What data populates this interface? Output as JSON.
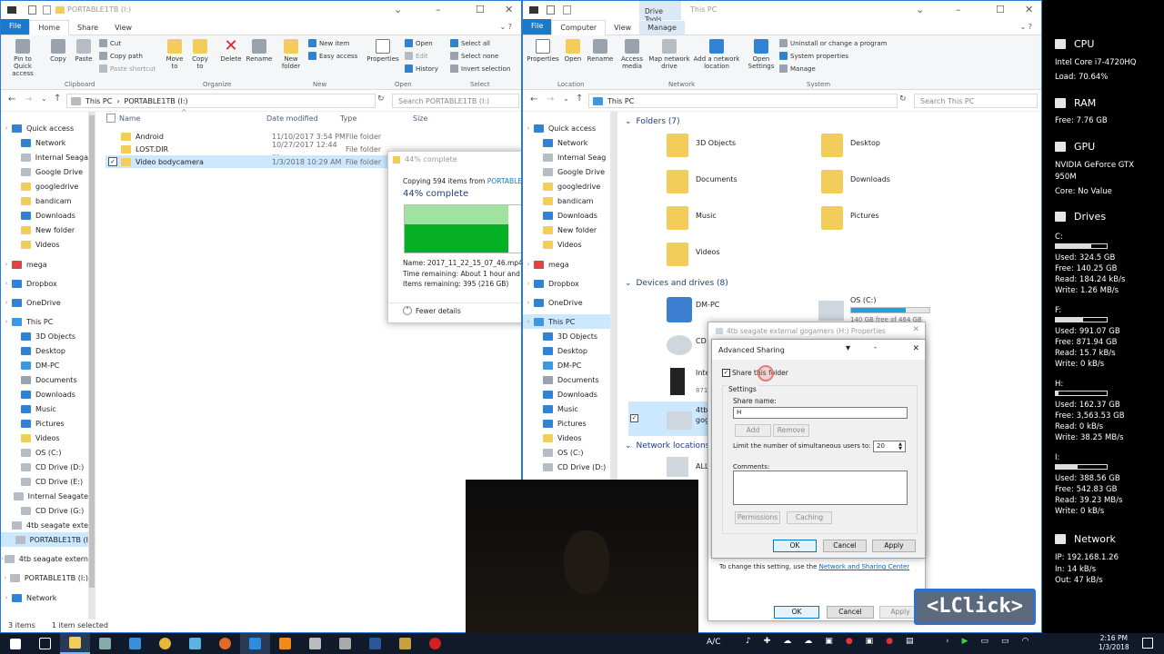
{
  "left": {
    "title": "PORTABLE1TB (I:)",
    "tabs": {
      "file": "File",
      "home": "Home",
      "share": "Share",
      "view": "View"
    },
    "ribbon": {
      "pin": "Pin to Quick access",
      "copy": "Copy",
      "paste": "Paste",
      "cut": "Cut",
      "copy_path": "Copy path",
      "paste_shortcut": "Paste shortcut",
      "move_to": "Move to",
      "copy_to": "Copy to",
      "delete": "Delete",
      "rename": "Rename",
      "new_folder": "New folder",
      "new_item": "New item",
      "easy_access": "Easy access",
      "properties": "Properties",
      "open": "Open",
      "edit": "Edit",
      "history": "History",
      "select_all": "Select all",
      "select_none": "Select none",
      "invert_selection": "Invert selection",
      "groups": {
        "clipboard": "Clipboard",
        "organize": "Organize",
        "new": "New",
        "open": "Open",
        "select": "Select"
      }
    },
    "address": {
      "root": "This PC",
      "path": "PORTABLE1TB (I:)",
      "search": "Search PORTABLE1TB (I:)"
    },
    "nav": [
      "Quick access",
      "Network",
      "Internal Seaga",
      "Google Drive",
      "googledrive",
      "bandicam",
      "Downloads",
      "New folder",
      "Videos",
      "mega",
      "Dropbox",
      "OneDrive",
      "This PC",
      "3D Objects",
      "Desktop",
      "DM-PC",
      "Documents",
      "Downloads",
      "Music",
      "Pictures",
      "Videos",
      "OS (C:)",
      "CD Drive (D:)",
      "CD Drive (E:)",
      "Internal Seagate",
      "CD Drive (G:)",
      "4tb seagate exte",
      "PORTABLE1TB (I",
      "4tb seagate extern",
      "PORTABLE1TB (I:)",
      "Network"
    ],
    "columns": {
      "name": "Name",
      "date": "Date modified",
      "type": "Type",
      "size": "Size"
    },
    "files": [
      {
        "name": "Android",
        "date": "11/10/2017 3:54 PM",
        "type": "File folder"
      },
      {
        "name": "LOST.DIR",
        "date": "10/27/2017 12:44 ...",
        "type": "File folder"
      },
      {
        "name": "Video bodycamera",
        "date": "1/3/2018 10:29 AM",
        "type": "File folder"
      }
    ],
    "status": {
      "items": "3 items",
      "selected": "1 item selected"
    }
  },
  "copy_dialog": {
    "title": "44% complete",
    "copying": "Copying 594 items from",
    "source": "PORTABLE1T",
    "percent": "44% complete",
    "name": "Name: 2017_11_22_15_07_46.mp4",
    "time": "Time remaining: About 1 hour and 35",
    "items": "Items remaining: 395 (216 GB)",
    "fewer": "Fewer details",
    "progress": 0.44
  },
  "right": {
    "title": "This PC",
    "tool_tab": "Drive Tools",
    "tabs": {
      "file": "File",
      "computer": "Computer",
      "view": "View",
      "manage": "Manage"
    },
    "ribbon": {
      "properties": "Properties",
      "open": "Open",
      "rename": "Rename",
      "access_media": "Access media",
      "map_drive": "Map network drive",
      "add_location": "Add a network location",
      "open_settings": "Open Settings",
      "uninstall": "Uninstall or change a program",
      "sys_props": "System properties",
      "manage": "Manage",
      "groups": {
        "location": "Location",
        "network": "Network",
        "system": "System"
      }
    },
    "address": {
      "path": "This PC",
      "search": "Search This PC"
    },
    "nav": [
      "Quick access",
      "Network",
      "Internal Seag",
      "Google Drive",
      "googledrive",
      "bandicam",
      "Downloads",
      "New folder",
      "Videos",
      "mega",
      "Dropbox",
      "OneDrive",
      "This PC",
      "3D Objects",
      "Desktop",
      "DM-PC",
      "Documents",
      "Downloads",
      "Music",
      "Pictures",
      "Videos",
      "OS (C:)",
      "CD Drive (D:)"
    ],
    "folders_header": "Folders (7)",
    "folders": [
      "3D Objects",
      "Desktop",
      "Documents",
      "Downloads",
      "Music",
      "Pictures",
      "Videos"
    ],
    "devices_header": "Devices and drives (8)",
    "devices": {
      "dmpc": "DM-PC",
      "osc": "OS (C:)",
      "osc_free": "140 GB free of 464 GB",
      "cd": "CD",
      "inte": "Inte",
      "inte_sub": "871",
      "tb": "4tb",
      "tb_sub": "gog"
    },
    "network_header": "Network locations",
    "network_item": "ALL"
  },
  "properties": {
    "title": "4tb seagate external gogamers (H:) Properties",
    "note": "To change this setting, use the",
    "link": "Network and Sharing Center",
    "ok": "OK",
    "cancel": "Cancel",
    "apply": "Apply"
  },
  "adv_sharing": {
    "title": "Advanced Sharing",
    "share": "Share this folder",
    "settings": "Settings",
    "share_name_label": "Share name:",
    "share_name": "H",
    "add": "Add",
    "remove": "Remove",
    "limit": "Limit the number of simultaneous users to:",
    "limit_value": "20",
    "comments": "Comments:",
    "permissions": "Permissions",
    "caching": "Caching",
    "ok": "OK",
    "cancel": "Cancel",
    "apply": "Apply"
  },
  "overlay": "<LClick>",
  "monitor": {
    "cpu": {
      "title": "CPU",
      "model": "Intel Core i7-4720HQ",
      "load": "Load: 70.64%"
    },
    "ram": {
      "title": "RAM",
      "free": "Free: 7.76 GB"
    },
    "gpu": {
      "title": "GPU",
      "model1": "NVIDIA GeForce GTX",
      "model2": "950M",
      "core": "Core: No Value"
    },
    "drives_title": "Drives",
    "drives": [
      {
        "letter": "C:",
        "used": "Used: 324.5 GB",
        "free": "Free: 140.25 GB",
        "read": "Read: 184.24 kB/s",
        "write": "Write: 1.26 MB/s",
        "fill": 0.7
      },
      {
        "letter": "F:",
        "used": "Used: 991.07 GB",
        "free": "Free: 871.94 GB",
        "read": "Read: 15.7 kB/s",
        "write": "Write: 0 kB/s",
        "fill": 0.53
      },
      {
        "letter": "H:",
        "used": "Used: 162.37 GB",
        "free": "Free: 3,563.53 GB",
        "read": "Read: 0 kB/s",
        "write": "Write: 38.25 MB/s",
        "fill": 0.05
      },
      {
        "letter": "I:",
        "used": "Used: 388.56 GB",
        "free": "Free: 542.83 GB",
        "read": "Read: 39.23 MB/s",
        "write": "Write: 0 kB/s",
        "fill": 0.42
      }
    ],
    "network": {
      "title": "Network",
      "ip": "IP: 192.168.1.26",
      "in": "In: 14 kB/s",
      "out": "Out: 47 kB/s"
    }
  },
  "taskbar": {
    "ac": "A/C",
    "time": "2:16 PM",
    "date": "1/3/2018"
  },
  "colors": {
    "accent": "#1979ca",
    "progress": "#06b025",
    "select": "#cce8ff"
  }
}
